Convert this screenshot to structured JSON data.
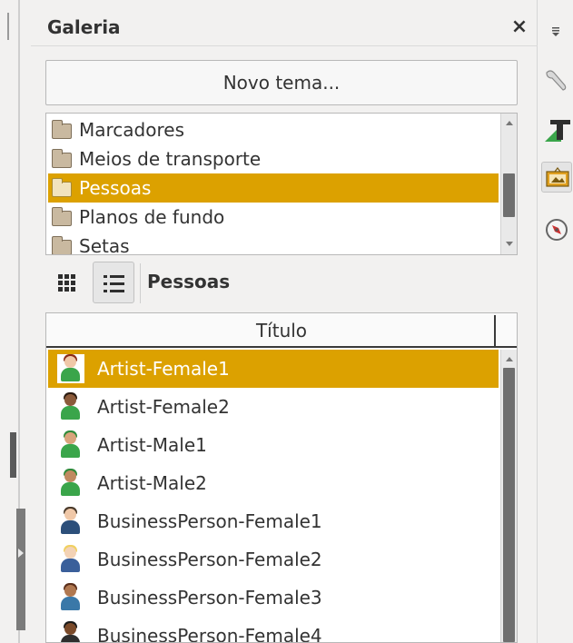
{
  "deck": {
    "title": "Galeria",
    "close_label": "×"
  },
  "new_theme_label": "Novo tema...",
  "themes": [
    {
      "label": "Marcadores",
      "selected": false
    },
    {
      "label": "Meios de transporte",
      "selected": false
    },
    {
      "label": "Pessoas",
      "selected": true
    },
    {
      "label": "Planos de fundo",
      "selected": false
    },
    {
      "label": "Setas",
      "selected": false
    }
  ],
  "view": {
    "current_theme": "Pessoas",
    "mode": "list"
  },
  "items_table": {
    "column_header": "Título",
    "rows": [
      {
        "label": "Artist-Female1",
        "selected": true,
        "icon": "artist-female-icon"
      },
      {
        "label": "Artist-Female2",
        "selected": false,
        "icon": "artist-female-icon"
      },
      {
        "label": "Artist-Male1",
        "selected": false,
        "icon": "artist-male-icon"
      },
      {
        "label": "Artist-Male2",
        "selected": false,
        "icon": "artist-male-icon"
      },
      {
        "label": "BusinessPerson-Female1",
        "selected": false,
        "icon": "businessperson-female-icon"
      },
      {
        "label": "BusinessPerson-Female2",
        "selected": false,
        "icon": "businessperson-female-icon"
      },
      {
        "label": "BusinessPerson-Female3",
        "selected": false,
        "icon": "businessperson-female-icon"
      },
      {
        "label": "BusinessPerson-Female4",
        "selected": false,
        "icon": "businessperson-female-icon"
      }
    ]
  },
  "sidebar_tabs": [
    {
      "icon": "menu-icon",
      "active": false
    },
    {
      "icon": "properties-icon",
      "active": false
    },
    {
      "icon": "styles-icon",
      "active": false
    },
    {
      "icon": "gallery-icon",
      "active": true
    },
    {
      "icon": "navigator-icon",
      "active": false
    }
  ],
  "colors": {
    "selection": "#dca100",
    "panel": "#f2f1f0"
  }
}
